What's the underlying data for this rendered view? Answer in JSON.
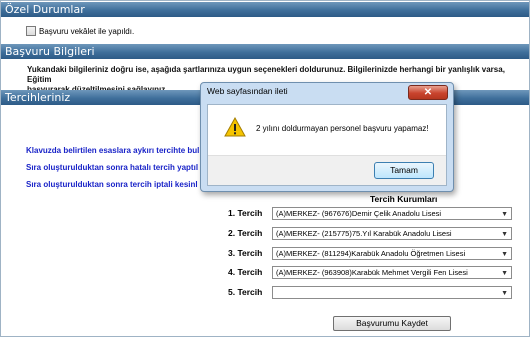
{
  "sections": {
    "ozel": "Özel Durumlar",
    "basvuru": "Başvuru Bilgileri",
    "tercih": "Tercihleriniz"
  },
  "proxy": {
    "label": "Başvuru vekâlet ile yapıldı."
  },
  "info": {
    "line1": "Yukandaki bilgileriniz doğru ise, aşağıda şartlarınıza uygun seçenekleri doldurunuz. Bilgilerinizde herhangi bir yanlışlık varsa, Eğitim",
    "line2": "başvurarak düzeltilmesini sağlayınız."
  },
  "rules": [
    "Klavuzda belirtilen esaslara aykırı tercihte bul",
    "Sıra oluşturulduktan sonra hatalı tercih yaptıl",
    "Sıra oluşturulduktan sonra tercih iptali kesinl"
  ],
  "preferences": {
    "header": "Tercih Kurumları",
    "items": [
      {
        "label": "1. Tercih",
        "value": "(A)MERKEZ- (967676)Demir Çelik Anadolu Lisesi"
      },
      {
        "label": "2. Tercih",
        "value": "(A)MERKEZ- (215775)75.Yıl Karabük Anadolu Lisesi"
      },
      {
        "label": "3. Tercih",
        "value": "(A)MERKEZ- (811294)Karabük Anadolu Öğretmen Lisesi"
      },
      {
        "label": "4. Tercih",
        "value": "(A)MERKEZ- (963908)Karabük Mehmet Vergili Fen Lisesi"
      },
      {
        "label": "5. Tercih",
        "value": ""
      }
    ]
  },
  "save_button": "Başvurumu Kaydet",
  "dialog": {
    "title": "Web sayfasından ileti",
    "close": "✕",
    "message": "2 yılını doldurmayan personel başvuru yapamaz!",
    "ok": "Tamam",
    "icon": "warning-icon"
  }
}
